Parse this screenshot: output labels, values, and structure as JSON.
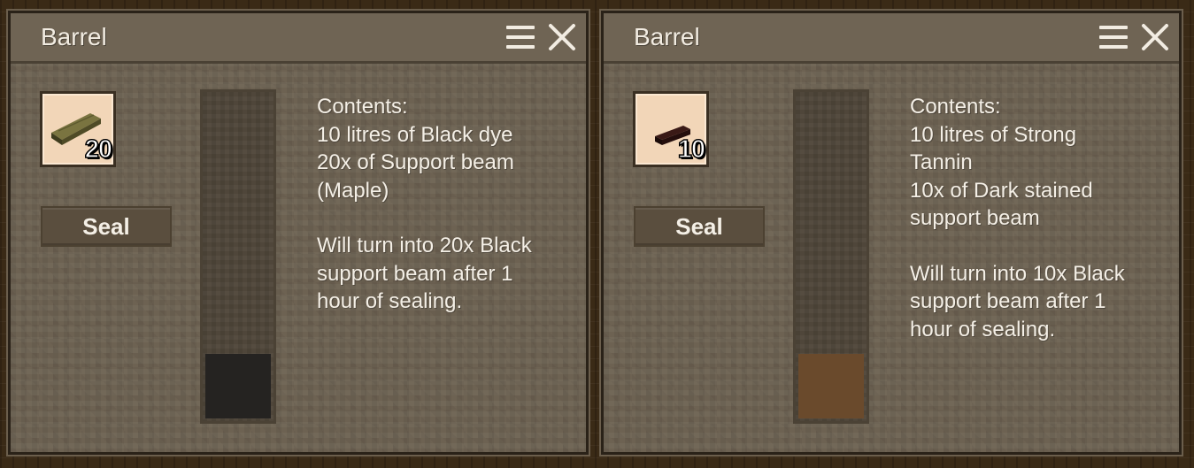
{
  "panels": [
    {
      "title": "Barrel",
      "slot": {
        "item_icon": "support-beam-maple-icon",
        "item_color": "#5e5a2e",
        "count": "20"
      },
      "seal_label": "Seal",
      "liquid": {
        "fill_fraction": 0.2,
        "color": "#252321"
      },
      "contents": {
        "heading": "Contents:",
        "lines": [
          "10 litres of Black dye",
          "20x of Support beam",
          "(Maple)"
        ],
        "result_lines": [
          "Will turn into 20x Black",
          "support beam after 1",
          "hour of sealing."
        ]
      }
    },
    {
      "title": "Barrel",
      "slot": {
        "item_icon": "dark-stained-support-beam-icon",
        "item_color": "#2a1210",
        "count": "10"
      },
      "seal_label": "Seal",
      "liquid": {
        "fill_fraction": 0.2,
        "color": "#6a4a2c"
      },
      "contents": {
        "heading": "Contents:",
        "lines": [
          "10 litres of Strong",
          "Tannin",
          "10x of Dark stained",
          "support beam"
        ],
        "result_lines": [
          "Will turn into 10x Black",
          "support beam after 1",
          "hour of sealing."
        ]
      }
    }
  ]
}
